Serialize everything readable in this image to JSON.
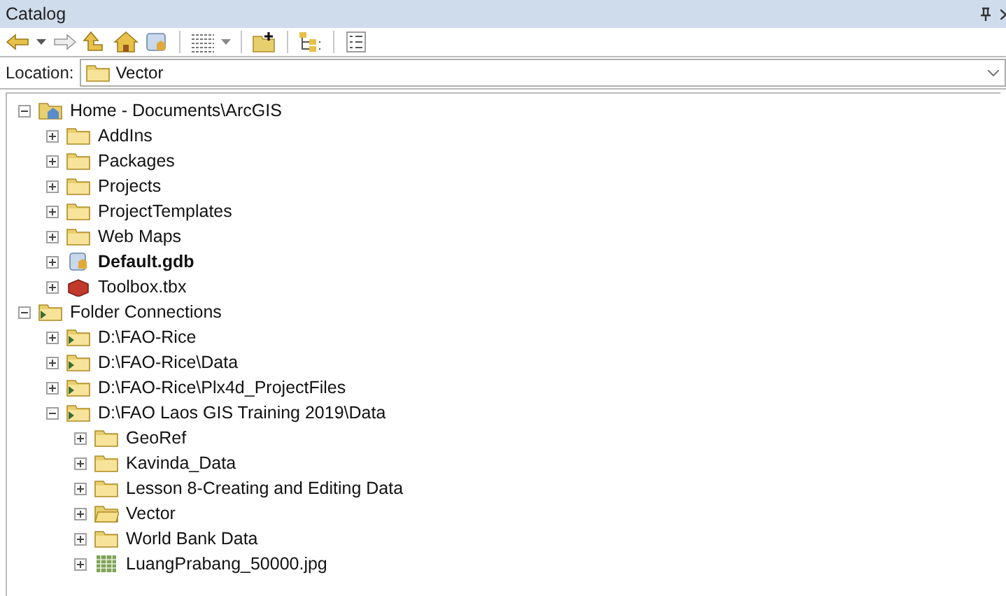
{
  "window": {
    "title": "Catalog"
  },
  "location": {
    "label": "Location:",
    "value": "Vector"
  },
  "tree": [
    {
      "label": "Home - Documents\\ArcGIS",
      "kind": "home",
      "expanded": true,
      "children": [
        {
          "label": "AddIns",
          "kind": "folder",
          "expanded": false
        },
        {
          "label": "Packages",
          "kind": "folder",
          "expanded": false
        },
        {
          "label": "Projects",
          "kind": "folder",
          "expanded": false
        },
        {
          "label": "ProjectTemplates",
          "kind": "folder",
          "expanded": false
        },
        {
          "label": "Web Maps",
          "kind": "folder",
          "expanded": false
        },
        {
          "label": "Default.gdb",
          "kind": "gdb",
          "expanded": false,
          "bold": true
        },
        {
          "label": "Toolbox.tbx",
          "kind": "toolbox",
          "expanded": false
        }
      ]
    },
    {
      "label": "Folder Connections",
      "kind": "connection",
      "expanded": true,
      "children": [
        {
          "label": "D:\\FAO-Rice",
          "kind": "connection",
          "expanded": false
        },
        {
          "label": "D:\\FAO-Rice\\Data",
          "kind": "connection",
          "expanded": false
        },
        {
          "label": "D:\\FAO-Rice\\Plx4d_ProjectFiles",
          "kind": "connection",
          "expanded": false
        },
        {
          "label": "D:\\FAO Laos GIS Training 2019\\Data",
          "kind": "connection",
          "expanded": true,
          "children": [
            {
              "label": "GeoRef",
              "kind": "folder",
              "expanded": false
            },
            {
              "label": "Kavinda_Data",
              "kind": "folder",
              "expanded": false
            },
            {
              "label": "Lesson 8-Creating and Editing Data",
              "kind": "folder",
              "expanded": false
            },
            {
              "label": "Vector",
              "kind": "folder-open",
              "expanded": false
            },
            {
              "label": "World Bank Data",
              "kind": "folder",
              "expanded": false
            },
            {
              "label": "LuangPrabang_50000.jpg",
              "kind": "raster",
              "expanded": false
            }
          ]
        }
      ]
    }
  ]
}
